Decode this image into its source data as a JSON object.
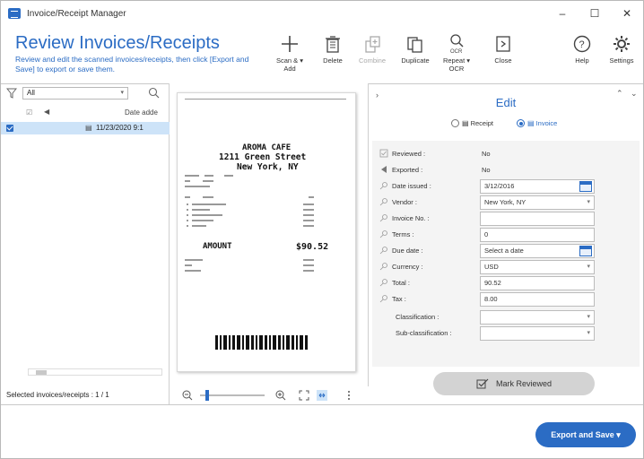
{
  "window": {
    "title": "Invoice/Receipt Manager",
    "controls": [
      "–",
      "☐",
      "✕"
    ]
  },
  "header": {
    "title": "Review Invoices/Receipts",
    "subtitle": "Review and edit the scanned invoices/receipts, then click [Export and Save] to export or save them.",
    "tools": [
      {
        "label": "Scan & ▾ Add",
        "icon": "plus-icon",
        "enabled": true
      },
      {
        "label": "Delete",
        "icon": "trash-icon",
        "enabled": true
      },
      {
        "label": "Combine",
        "icon": "combine-icon",
        "enabled": false
      },
      {
        "label": "Duplicate",
        "icon": "duplicate-icon",
        "enabled": true
      },
      {
        "label": "Repeat ▾ OCR",
        "icon": "ocr-icon",
        "enabled": true
      },
      {
        "label": "Close",
        "icon": "close-doc-icon",
        "enabled": true
      },
      {
        "label": "Help",
        "icon": "help-icon",
        "enabled": true
      },
      {
        "label": "Settings",
        "icon": "gear-icon",
        "enabled": true
      }
    ]
  },
  "left": {
    "filter_value": "All",
    "columns": [
      "",
      "",
      "Date adde"
    ],
    "rows": [
      {
        "checked": true,
        "date": "11/23/2020 9:1"
      }
    ],
    "status": "Selected invoices/receipts : 1 / 1"
  },
  "receipt": {
    "name": "AROMA CAFE",
    "street": "1211 Green Street",
    "city": "New York, NY",
    "amount_label": "AMOUNT",
    "amount": "$90.52"
  },
  "edit": {
    "title": "Edit",
    "doc_types": [
      "Receipt",
      "Invoice"
    ],
    "selected_type": "Invoice",
    "fields": [
      {
        "label": "Reviewed :",
        "value": "No",
        "kind": "text"
      },
      {
        "label": "Exported :",
        "value": "No",
        "kind": "text"
      },
      {
        "label": "Date issued :",
        "value": "3/12/2016",
        "kind": "date"
      },
      {
        "label": "Vendor :",
        "value": "New York, NY",
        "kind": "dropdown"
      },
      {
        "label": "Invoice No. :",
        "value": "",
        "kind": "input"
      },
      {
        "label": "Terms :",
        "value": "0",
        "kind": "input"
      },
      {
        "label": "Due date :",
        "value": "Select a date",
        "kind": "date"
      },
      {
        "label": "Currency :",
        "value": "USD",
        "kind": "dropdown"
      },
      {
        "label": "Total :",
        "value": "90.52",
        "kind": "input"
      },
      {
        "label": "Tax :",
        "value": "8.00",
        "kind": "input"
      },
      {
        "label": "Classification :",
        "value": "",
        "kind": "dropdown"
      },
      {
        "label": "Sub-classification :",
        "value": "",
        "kind": "dropdown"
      }
    ],
    "mark_reviewed": "Mark Reviewed"
  },
  "footer": {
    "export_label": "Export and Save ▾"
  },
  "colors": {
    "accent": "#2b6cc4",
    "selection": "#cde3f8"
  }
}
